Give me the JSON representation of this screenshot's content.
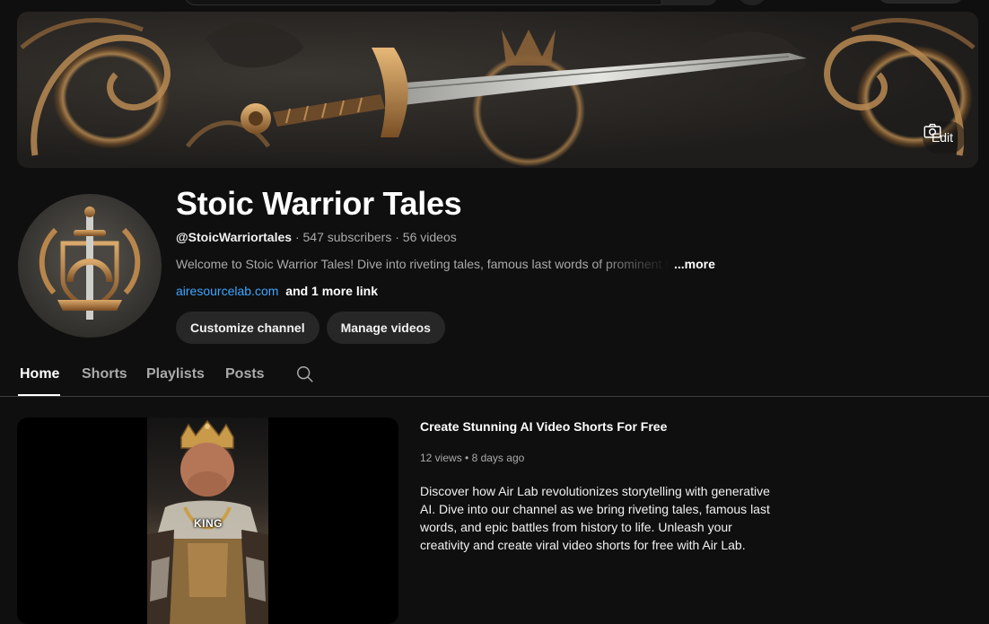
{
  "banner": {
    "edit_label": "Edit"
  },
  "channel": {
    "name": "Stoic Warrior Tales",
    "handle": "@StoicWarriortales",
    "subscribers": "547 subscribers",
    "videos": "56 videos",
    "separator": "·",
    "description": "Welcome to Stoic Warrior Tales! Dive into riveting tales, famous last words of prominent f",
    "description_more": "...more",
    "link": "airesourcelab.com",
    "more_links": "and 1 more link",
    "buttons": {
      "customize": "Customize channel",
      "manage": "Manage videos"
    }
  },
  "tabs": [
    {
      "label": "Home",
      "active": true
    },
    {
      "label": "Shorts",
      "active": false
    },
    {
      "label": "Playlists",
      "active": false
    },
    {
      "label": "Posts",
      "active": false
    }
  ],
  "featured_video": {
    "overlay_text": "KING",
    "title": "Create Stunning AI Video Shorts For Free",
    "views": "12 views",
    "age": "8 days ago",
    "meta_separator": "•",
    "description": "Discover how Air Lab revolutionizes storytelling with generative AI. Dive into our channel as we bring riveting tales, famous last words, and epic battles from history to life. Unleash your creativity and create viral video shorts for free with Air Lab."
  },
  "colors": {
    "background": "#0f0f0f",
    "link": "#3ea6ff",
    "pill": "#272727",
    "muted_text": "#aaaaaa"
  }
}
